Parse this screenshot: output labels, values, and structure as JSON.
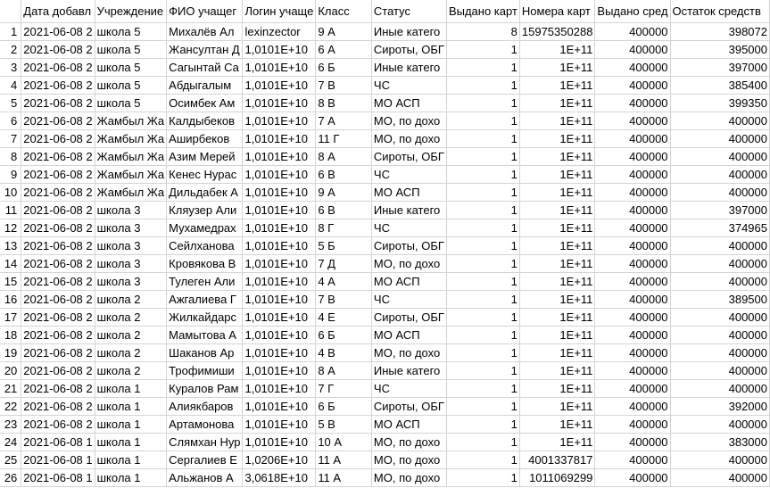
{
  "headers": [
    "Дата добавл",
    "Учреждение",
    "ФИО учащег",
    "Логин учаще",
    "Класс",
    "Статус",
    "Выдано карт",
    "Номера карт",
    "Выдано сред",
    "Остаток средств"
  ],
  "rows": [
    {
      "n": "1",
      "date": "2021-06-08 2",
      "school": "школа 5",
      "fio": "Михалёв Ал",
      "login": "lexinzector",
      "cls": "9 А",
      "status": "Иные катего",
      "cards": "8",
      "card_no": "15975350288",
      "issued": "400000",
      "rest": "398072"
    },
    {
      "n": "2",
      "date": "2021-06-08 2",
      "school": "школа 5",
      "fio": "Жансултан Д",
      "login": "1,0101E+10",
      "cls": "6 А",
      "status": "Сироты, ОБГ",
      "cards": "1",
      "card_no": "1E+11",
      "issued": "400000",
      "rest": "395000"
    },
    {
      "n": "3",
      "date": "2021-06-08 2",
      "school": "школа 5",
      "fio": "Сагынтай Са",
      "login": "1,0101E+10",
      "cls": "6 Б",
      "status": "Иные катего",
      "cards": "1",
      "card_no": "1E+11",
      "issued": "400000",
      "rest": "397000"
    },
    {
      "n": "4",
      "date": "2021-06-08 2",
      "school": "школа 5",
      "fio": "Абдыгалым",
      "login": "1,0101E+10",
      "cls": "7 В",
      "status": "ЧС",
      "cards": "1",
      "card_no": "1E+11",
      "issued": "400000",
      "rest": "385400"
    },
    {
      "n": "5",
      "date": "2021-06-08 2",
      "school": "школа 5",
      "fio": "Осимбек Ам",
      "login": "1,0101E+10",
      "cls": "8 В",
      "status": "МО АСП",
      "cards": "1",
      "card_no": "1E+11",
      "issued": "400000",
      "rest": "399350"
    },
    {
      "n": "6",
      "date": "2021-06-08 2",
      "school": "Жамбыл Жа",
      "fio": "Калдыбеков",
      "login": "1,0101E+10",
      "cls": "7 А",
      "status": "МО, по дохо",
      "cards": "1",
      "card_no": "1E+11",
      "issued": "400000",
      "rest": "400000"
    },
    {
      "n": "7",
      "date": "2021-06-08 2",
      "school": "Жамбыл Жа",
      "fio": "Аширбеков",
      "login": "1,0101E+10",
      "cls": "11 Г",
      "status": "МО, по дохо",
      "cards": "1",
      "card_no": "1E+11",
      "issued": "400000",
      "rest": "400000"
    },
    {
      "n": "8",
      "date": "2021-06-08 2",
      "school": "Жамбыл Жа",
      "fio": "Азим Мерей",
      "login": "1,0101E+10",
      "cls": "8 А",
      "status": "Сироты, ОБГ",
      "cards": "1",
      "card_no": "1E+11",
      "issued": "400000",
      "rest": "400000"
    },
    {
      "n": "9",
      "date": "2021-06-08 2",
      "school": "Жамбыл Жа",
      "fio": "Кенес Нурас",
      "login": "1,0101E+10",
      "cls": "6 В",
      "status": "ЧС",
      "cards": "1",
      "card_no": "1E+11",
      "issued": "400000",
      "rest": "400000"
    },
    {
      "n": "10",
      "date": "2021-06-08 2",
      "school": "Жамбыл Жа",
      "fio": "Дильдабек А",
      "login": "1,0101E+10",
      "cls": "9 А",
      "status": "МО АСП",
      "cards": "1",
      "card_no": "1E+11",
      "issued": "400000",
      "rest": "400000"
    },
    {
      "n": "11",
      "date": "2021-06-08 2",
      "school": "школа 3",
      "fio": "Кляузер Али",
      "login": "1,0101E+10",
      "cls": "6 В",
      "status": "Иные катего",
      "cards": "1",
      "card_no": "1E+11",
      "issued": "400000",
      "rest": "397000"
    },
    {
      "n": "12",
      "date": "2021-06-08 2",
      "school": "школа 3",
      "fio": "Мухамедрах",
      "login": "1,0101E+10",
      "cls": "8 Г",
      "status": "ЧС",
      "cards": "1",
      "card_no": "1E+11",
      "issued": "400000",
      "rest": "374965"
    },
    {
      "n": "13",
      "date": "2021-06-08 2",
      "school": "школа 3",
      "fio": "Сейлханова",
      "login": "1,0101E+10",
      "cls": "5 Б",
      "status": "Сироты, ОБГ",
      "cards": "1",
      "card_no": "1E+11",
      "issued": "400000",
      "rest": "400000"
    },
    {
      "n": "14",
      "date": "2021-06-08 2",
      "school": "школа 3",
      "fio": "Кровякова В",
      "login": "1,0101E+10",
      "cls": "7 Д",
      "status": "МО, по дохо",
      "cards": "1",
      "card_no": "1E+11",
      "issued": "400000",
      "rest": "400000"
    },
    {
      "n": "15",
      "date": "2021-06-08 2",
      "school": "школа 3",
      "fio": "Тулеген Али",
      "login": "1,0101E+10",
      "cls": "4 А",
      "status": "МО АСП",
      "cards": "1",
      "card_no": "1E+11",
      "issued": "400000",
      "rest": "400000"
    },
    {
      "n": "16",
      "date": "2021-06-08 2",
      "school": "школа 2",
      "fio": "Ажгалиева Г",
      "login": "1,0101E+10",
      "cls": "7 В",
      "status": "ЧС",
      "cards": "1",
      "card_no": "1E+11",
      "issued": "400000",
      "rest": "389500"
    },
    {
      "n": "17",
      "date": "2021-06-08 2",
      "school": "школа 2",
      "fio": "Жилкайдарс",
      "login": "1,0101E+10",
      "cls": "4 Е",
      "status": "Сироты, ОБГ",
      "cards": "1",
      "card_no": "1E+11",
      "issued": "400000",
      "rest": "400000"
    },
    {
      "n": "18",
      "date": "2021-06-08 2",
      "school": "школа 2",
      "fio": "Мамытова А",
      "login": "1,0101E+10",
      "cls": "6 Б",
      "status": "МО АСП",
      "cards": "1",
      "card_no": "1E+11",
      "issued": "400000",
      "rest": "400000"
    },
    {
      "n": "19",
      "date": "2021-06-08 2",
      "school": "школа 2",
      "fio": "Шаканов Ар",
      "login": "1,0101E+10",
      "cls": "4 В",
      "status": "МО, по дохо",
      "cards": "1",
      "card_no": "1E+11",
      "issued": "400000",
      "rest": "400000"
    },
    {
      "n": "20",
      "date": "2021-06-08 2",
      "school": "школа 2",
      "fio": "Трофимиши",
      "login": "1,0101E+10",
      "cls": "8 А",
      "status": "Иные катего",
      "cards": "1",
      "card_no": "1E+11",
      "issued": "400000",
      "rest": "400000"
    },
    {
      "n": "21",
      "date": "2021-06-08 2",
      "school": "школа 1",
      "fio": "Куралов Рам",
      "login": "1,0101E+10",
      "cls": "7 Г",
      "status": "ЧС",
      "cards": "1",
      "card_no": "1E+11",
      "issued": "400000",
      "rest": "400000"
    },
    {
      "n": "22",
      "date": "2021-06-08 2",
      "school": "школа 1",
      "fio": "Алиякбаров",
      "login": "1,0101E+10",
      "cls": "6 Б",
      "status": "Сироты, ОБГ",
      "cards": "1",
      "card_no": "1E+11",
      "issued": "400000",
      "rest": "392000"
    },
    {
      "n": "23",
      "date": "2021-06-08 2",
      "school": "школа 1",
      "fio": "Артамонова",
      "login": "1,0101E+10",
      "cls": "5 В",
      "status": "МО АСП",
      "cards": "1",
      "card_no": "1E+11",
      "issued": "400000",
      "rest": "400000"
    },
    {
      "n": "24",
      "date": "2021-06-08 1",
      "school": "школа 1",
      "fio": "Слямхан Нур",
      "login": "1,0101E+10",
      "cls": "10 А",
      "status": "МО, по дохо",
      "cards": "1",
      "card_no": "1E+11",
      "issued": "400000",
      "rest": "383000"
    },
    {
      "n": "25",
      "date": "2021-06-08 1",
      "school": "школа 1",
      "fio": "Сергалиев Е",
      "login": "1,0206E+10",
      "cls": "11 А",
      "status": "МО, по дохо",
      "cards": "1",
      "card_no": "4001337817",
      "issued": "400000",
      "rest": "400000"
    },
    {
      "n": "26",
      "date": "2021-06-08 1",
      "school": "школа 1",
      "fio": "Альжанов А",
      "login": "3,0618E+10",
      "cls": "11 А",
      "status": "МО, по дохо",
      "cards": "1",
      "card_no": "1011069299",
      "issued": "400000",
      "rest": "400000"
    }
  ]
}
